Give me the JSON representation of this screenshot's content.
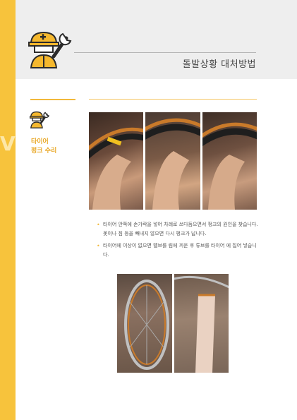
{
  "header": {
    "title": "돌발상황 대처방법"
  },
  "section": {
    "title_line1": "타이어",
    "title_line2": "펑크 수리"
  },
  "watermark": "Vi",
  "instructions": [
    "타이어 안쪽에 손가락을 넣어 차례로 쓰다듬으면서 펑크의 원인을 찾습니다. 못이나 침 등을 빼내지 않으면 다시 펑크가 납니다.",
    "타이어에 이상이 없으면 밸브를 림에 끼운 후 튜브를 타이어 에 집어 넣습니다."
  ],
  "colors": {
    "accent": "#f7c33c",
    "header_bg": "#eeeeee",
    "title_text": "#e9a92a"
  },
  "icons": [
    "mechanic-with-wrench-icon",
    "mechanic-small-icon",
    "bullet-dot-icon"
  ]
}
